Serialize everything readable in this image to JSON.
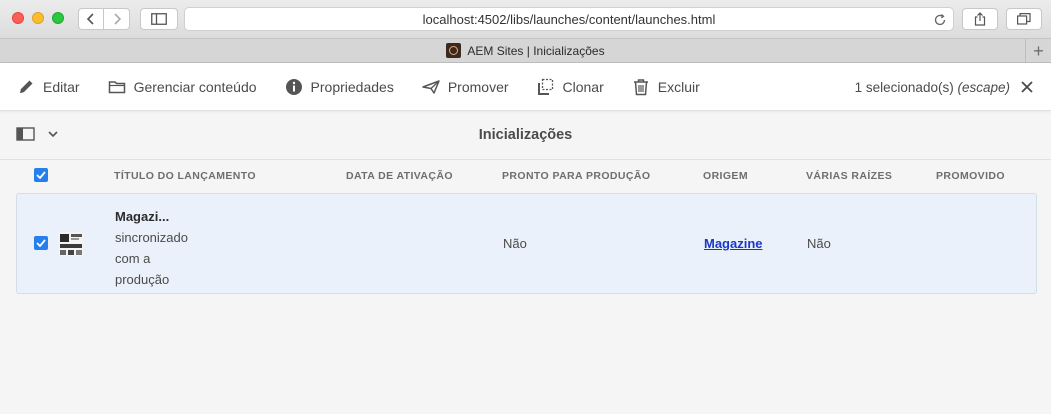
{
  "browser": {
    "url": "localhost:4502/libs/launches/content/launches.html",
    "tab_title": "AEM Sites | Inicializações",
    "new_tab_label": "+"
  },
  "actions": [
    {
      "label": "Editar",
      "icon": "pencil-icon"
    },
    {
      "label": "Gerenciar conteúdo",
      "icon": "folder-icon"
    },
    {
      "label": "Propriedades",
      "icon": "info-icon"
    },
    {
      "label": "Promover",
      "icon": "send-icon"
    },
    {
      "label": "Clonar",
      "icon": "copy-icon"
    },
    {
      "label": "Excluir",
      "icon": "trash-icon"
    }
  ],
  "selection": {
    "count_text": "1 selecionado(s)",
    "hint": "(escape)"
  },
  "page": {
    "title": "Inicializações"
  },
  "table": {
    "columns": [
      "TÍTULO DO LANÇAMENTO",
      "DATA DE ATIVAÇÃO",
      "PRONTO PARA PRODUÇÃO",
      "ORIGEM",
      "VÁRIAS RAÍZES",
      "PROMOVIDO"
    ],
    "rows": [
      {
        "title": "Magazi...",
        "status_line1": "sincronizado",
        "status_line2": "com a",
        "status_line3": "produção",
        "activation_date": "",
        "production_ready": "Não",
        "source": "Magazine",
        "multiple_roots": "Não",
        "promoted": ""
      }
    ]
  },
  "colors": {
    "accent": "#2680eb",
    "selected_row": "#eaf1fa",
    "link": "#1a38c8"
  }
}
